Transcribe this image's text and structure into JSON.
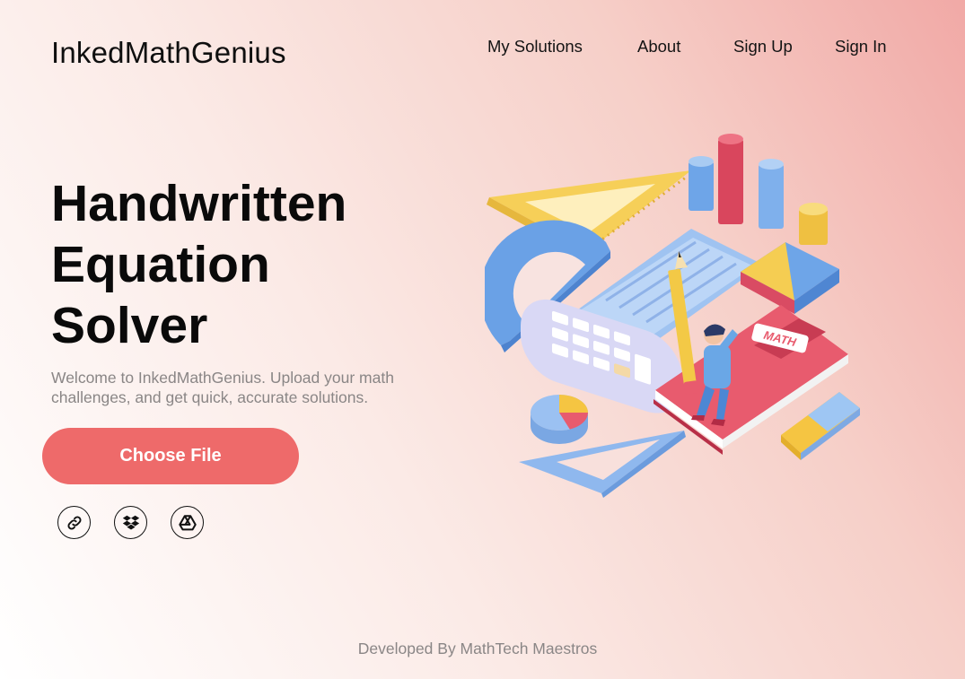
{
  "brand": {
    "name": "InkedMathGenius"
  },
  "nav": {
    "items": [
      {
        "label": "My Solutions"
      },
      {
        "label": "About"
      },
      {
        "label": "Sign Up"
      },
      {
        "label": "Sign In"
      }
    ]
  },
  "hero": {
    "title_lines": [
      "Handwritten",
      "Equation",
      "Solver"
    ],
    "subtitle": "Welcome to InkedMathGenius. Upload your math challenges, and get quick, accurate solutions.",
    "cta_label": "Choose File"
  },
  "upload_sources": [
    {
      "icon": "link-icon"
    },
    {
      "icon": "dropbox-icon"
    },
    {
      "icon": "google-drive-icon"
    }
  ],
  "illustration": {
    "book_label": "MATH"
  },
  "footer": {
    "text": "Developed By MathTech Maestros"
  },
  "colors": {
    "accent": "#ee6a6a",
    "text": "#0d0d0d",
    "muted": "#8a8686",
    "gradient_end": "#f1a9a6"
  }
}
